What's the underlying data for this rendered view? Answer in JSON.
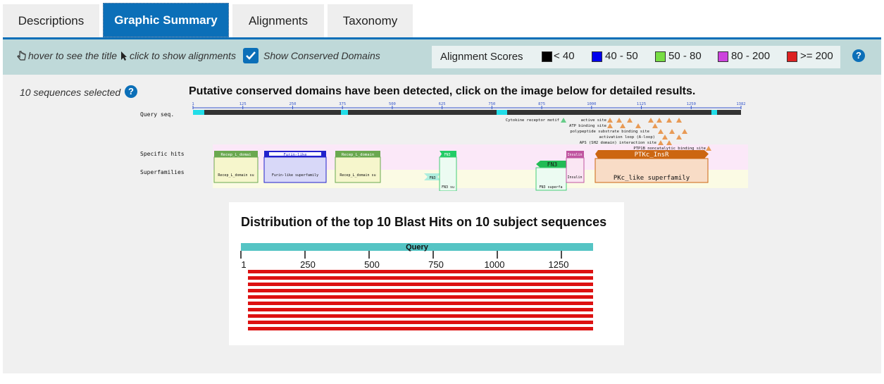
{
  "tabs": [
    {
      "label": "Descriptions"
    },
    {
      "label": "Graphic Summary"
    },
    {
      "label": "Alignments"
    },
    {
      "label": "Taxonomy"
    }
  ],
  "toolbar": {
    "hover_hint": "hover to see the title",
    "click_hint": "click to show alignments",
    "conserved_label": "Show Conserved Domains",
    "conserved_checked": true
  },
  "legend": {
    "title": "Alignment Scores",
    "items": [
      {
        "label": "< 40",
        "color": "#000000"
      },
      {
        "label": "40 - 50",
        "color": "#0000ee"
      },
      {
        "label": "50 - 80",
        "color": "#77dd44"
      },
      {
        "label": "80 - 200",
        "color": "#cc44dd"
      },
      {
        "label": ">= 200",
        "color": "#dd2222"
      }
    ]
  },
  "main": {
    "selected_text": "10 sequences selected",
    "cdd_title": "Putative conserved domains have been detected, click on the image below for detailed results."
  },
  "cdd": {
    "query_label": "Query seq.",
    "specific_label": "Specific hits",
    "superfamilies_label": "Superfamilies",
    "ticks": [
      "1",
      "125",
      "250",
      "375",
      "500",
      "625",
      "750",
      "875",
      "1000",
      "1125",
      "1250",
      "1382"
    ],
    "sites": [
      "Cytokine receptor motif",
      "active site",
      "ATP binding site",
      "polypeptide substrate binding site",
      "activation loop (A-loop)",
      "APS (SH2 domain) interaction site",
      "PTP1B noncatalytic binding site"
    ],
    "specific_hits": [
      "Recep_L_domai",
      "Furin-like",
      "Recep_L_domain",
      "FN3",
      "FN3",
      "Insulin",
      "PTKc_InsR"
    ],
    "superfamily_hits": [
      "Recep_L_domain su",
      "Furin-like superfamily",
      "Recep_L_domain su",
      "FN3",
      "FN3 su",
      "FN3 superfa",
      "Insulin",
      "PKc_like superfamily"
    ]
  },
  "blast": {
    "title": "Distribution of the top 10 Blast Hits on 10 subject sequences",
    "query_label": "Query",
    "axis_ticks": [
      "1",
      "250",
      "500",
      "750",
      "1000",
      "1250"
    ],
    "hit_count": 10,
    "hit_color": "#dd1111"
  }
}
